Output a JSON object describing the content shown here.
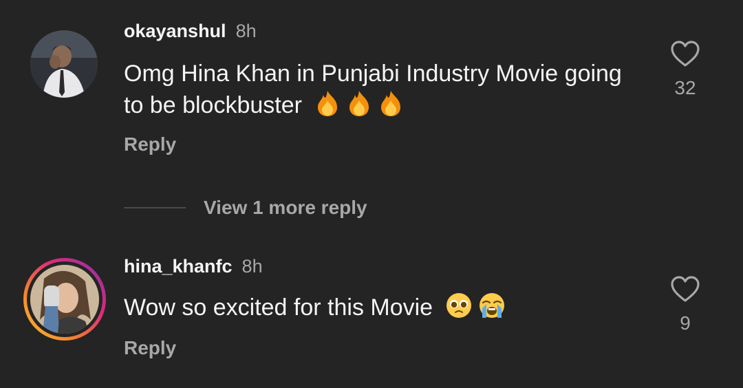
{
  "comments": [
    {
      "username": "okayanshul",
      "time": "8h",
      "text": "Omg Hina Khan in Punjabi Industry Movie going to be blockbuster",
      "emojis": [
        "fire",
        "fire",
        "fire"
      ],
      "reply_label": "Reply",
      "likes": "32"
    },
    {
      "username": "hina_khanfc",
      "time": "8h",
      "text": "Wow so excited for this Movie",
      "emojis": [
        "pleading-face",
        "loudly-crying-face"
      ],
      "reply_label": "Reply",
      "likes": "9"
    }
  ],
  "view_more_replies": "View 1 more reply",
  "icons": {
    "like": "heart-outline-icon"
  },
  "colors": {
    "background": "#242424",
    "primary_text": "#f5f5f5",
    "secondary_text": "#a8a8a8"
  }
}
